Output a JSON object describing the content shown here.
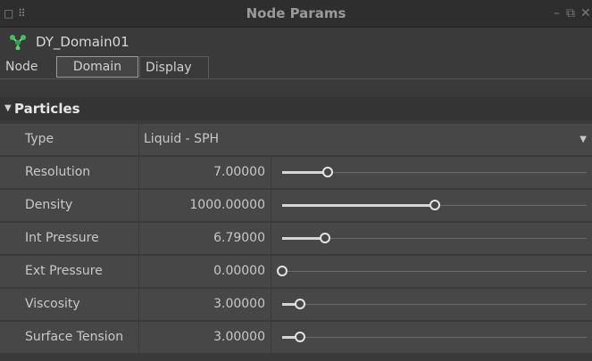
{
  "window": {
    "title": "Node Params",
    "controls": {
      "minimize": "–",
      "restore": "⧉",
      "close": "✕"
    }
  },
  "node": {
    "name": "DY_Domain01",
    "icon": "node-graph-icon"
  },
  "tabs": [
    {
      "label": "Node",
      "selected": false
    },
    {
      "label": "Domain",
      "selected": true
    },
    {
      "label": "Display",
      "selected": false
    }
  ],
  "section": {
    "label": "Particles",
    "expanded": true
  },
  "params": {
    "type": {
      "label": "Type",
      "value": "Liquid - SPH"
    },
    "sliders": [
      {
        "label": "Resolution",
        "value": "7.00000",
        "fraction": 0.15
      },
      {
        "label": "Density",
        "value": "1000.00000",
        "fraction": 0.5
      },
      {
        "label": "Int Pressure",
        "value": "6.79000",
        "fraction": 0.14
      },
      {
        "label": "Ext Pressure",
        "value": "0.00000",
        "fraction": 0.0
      },
      {
        "label": "Viscosity",
        "value": "3.00000",
        "fraction": 0.06
      },
      {
        "label": "Surface Tension",
        "value": "3.00000",
        "fraction": 0.06
      }
    ]
  }
}
